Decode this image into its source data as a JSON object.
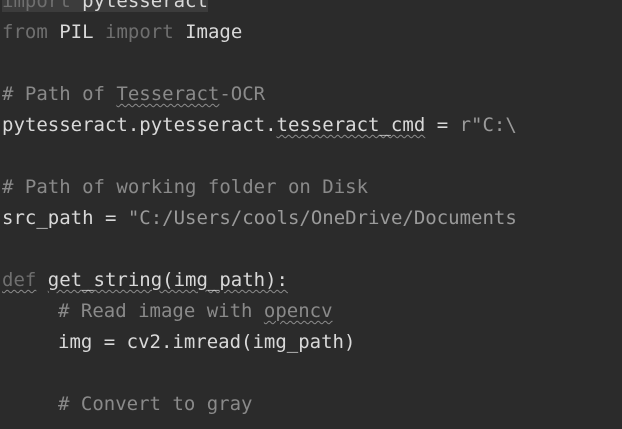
{
  "editor": {
    "line1": {
      "kw": "import",
      "sp": " ",
      "mod": "pytesseract"
    },
    "line2": {
      "kw_from": "from",
      "sp1": " ",
      "pil": "PIL",
      "sp2": " ",
      "kw_import": "import",
      "sp3": " ",
      "image": "Image"
    },
    "line3": {
      "prefix": "# Path of ",
      "tess": "Tesseract",
      "rest": "-OCR"
    },
    "line4": {
      "pre": "pytesseract.pytesseract.",
      "attr": "tesseract_cmd",
      "mid": " = ",
      "str": "r\"C:\\"
    },
    "line5": {
      "text": "# Path of working folder on Disk"
    },
    "line6": {
      "pre": "src_path = ",
      "str": "\"C:/Users/cools/OneDrive/Documents"
    },
    "line7": {
      "kw": "def",
      "sp": " ",
      "sig": "get_string(img_path):"
    },
    "line8": {
      "prefix": "# Read image with ",
      "word": "opencv"
    },
    "line9": {
      "text": "img = cv2.imread(img_path)"
    },
    "line10": {
      "text": "# Convert to gray"
    }
  }
}
